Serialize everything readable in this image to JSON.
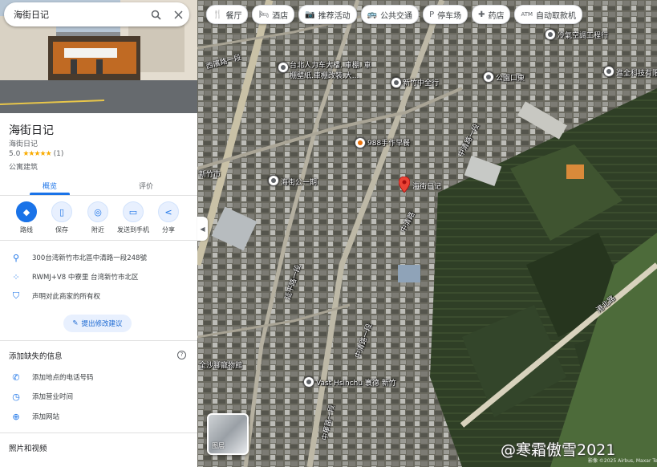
{
  "search": {
    "query": "海街日记"
  },
  "place": {
    "name": "海街日记",
    "subtitle": "海街日记",
    "rating": "5.0",
    "stars": "★★★★★",
    "reviews": "(1)",
    "category": "公寓建筑"
  },
  "tabs": [
    {
      "label": "概览"
    },
    {
      "label": "评价"
    }
  ],
  "actions": [
    {
      "label": "路线",
      "icon": "◆"
    },
    {
      "label": "保存",
      "icon": "▯"
    },
    {
      "label": "附近",
      "icon": "◎"
    },
    {
      "label": "发送到手机",
      "icon": "▭"
    },
    {
      "label": "分享",
      "icon": "<"
    }
  ],
  "info": {
    "address": "300台湾新竹市北區中清路一段248號",
    "plus_code": "RWMJ+V8 中寮里 台湾新竹市北区",
    "claim": "声明对此商家的所有权"
  },
  "suggest_edit": "提出修改建议",
  "missing_info": {
    "header": "添加缺失的信息",
    "items": [
      "添加地点的电话号码",
      "添加营业时间",
      "添加网站"
    ]
  },
  "photos_header": "照片和视频",
  "chips": [
    {
      "label": "餐厅",
      "icon": "🍴"
    },
    {
      "label": "酒店",
      "icon": "🛏"
    },
    {
      "label": "推荐活动",
      "icon": "📷"
    },
    {
      "label": "公共交通",
      "icon": "🚌"
    },
    {
      "label": "停车场",
      "icon": "P"
    },
    {
      "label": "药店",
      "icon": "✚"
    },
    {
      "label": "自动取款机",
      "icon": "ATM"
    }
  ],
  "map_labels": {
    "pin": "海街日记",
    "poi1": "台北人力车大樓. 車棚. 車棚壁紙.車棚改裝.大...",
    "poi2": "新竹中全行",
    "poi3": "公園口東",
    "poi4": "冷氣空調工程行",
    "poi5": "進全科技有限",
    "poi6": "988手作早餐",
    "poi7": "海街公一期",
    "poi8": "Vast Hsinchu 寰德 新竹",
    "poi9": "新竹市",
    "poi10": "全沙腳寵物館",
    "road1": "中清路一段",
    "road2": "中清路",
    "road3": "中清路一段",
    "road4": "中華路一段",
    "road5": "延平路一段",
    "road6": "西濱路一段",
    "road7": "港北路"
  },
  "layers_label": "图层",
  "watermark": "@寒霜傲雪2021",
  "attribution": "影像 ©2025 Airbus, Maxar Technologies"
}
